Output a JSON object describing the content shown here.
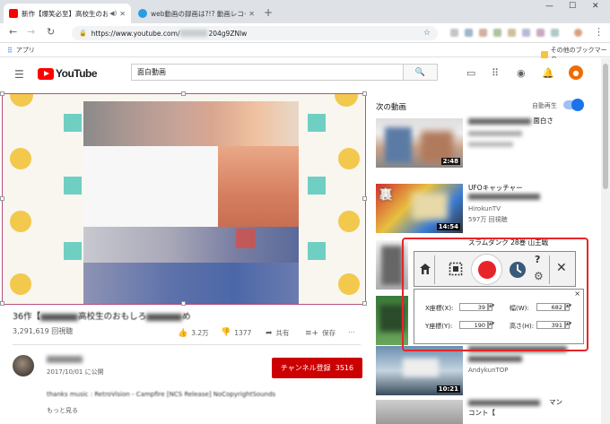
{
  "browser": {
    "tabs": [
      {
        "title": "新作【爆笑必至】高校生のおも",
        "active": true,
        "icon": "youtube-favicon"
      },
      {
        "title": "web動画の録画は?!? 動画レコー",
        "active": false,
        "icon": "globe-favicon"
      }
    ],
    "new_tab": "+",
    "window_controls": [
      "—",
      "☐",
      "✕"
    ],
    "url": "https://www.youtube.com/",
    "url_tail": "204g9ZNlw",
    "bookmarks_apps": "アプリ",
    "bookmarks_other": "その他のブックマーク"
  },
  "youtube": {
    "logo_text": "YouTube",
    "search_value": "面白動画",
    "video": {
      "title_prefix": "36作【",
      "title_suffix": "高校生のおもしろ",
      "title_end": "め",
      "views": "3,291,619 回視聴",
      "likes": "3.2万",
      "dislikes": "1377",
      "share": "共有",
      "save": "保存"
    },
    "channel": {
      "published": "2017/10/01 に公開",
      "subscribe": "チャンネル登録",
      "subscribers": "3516",
      "description": "thanks music : RetroVision - Campfire [NCS Release] NoCopyrightSounds",
      "show_more": "もっと見る"
    },
    "sidebar": {
      "up_next": "次の動画",
      "autoplay": "自動再生",
      "videos": [
        {
          "title": "面白さ",
          "channel": "",
          "views": "",
          "duration": "2:48"
        },
        {
          "title": "UFOキャッチャー",
          "channel": "HirokunTV",
          "views": "597万 回視聴",
          "duration": "14:54"
        },
        {
          "title": "スラムダンク 28巻 山王戦",
          "channel": "",
          "views": "",
          "duration": ""
        },
        {
          "title": "",
          "channel": "",
          "views": "",
          "duration": ""
        },
        {
          "title": "",
          "channel": "AndykunTOP",
          "views": "",
          "duration": "10:21"
        },
        {
          "title": "マン",
          "channel": "コント【",
          "views": "",
          "duration": ""
        }
      ]
    }
  },
  "capture_tool": {
    "x_label": "X座標(X):",
    "x_value": "39",
    "y_label": "Y座標(Y):",
    "y_value": "190",
    "width_label": "幅(W):",
    "width_value": "682",
    "height_label": "高さ(H):",
    "height_value": "391",
    "help": "?",
    "close": "✕",
    "panel_close": "×"
  }
}
